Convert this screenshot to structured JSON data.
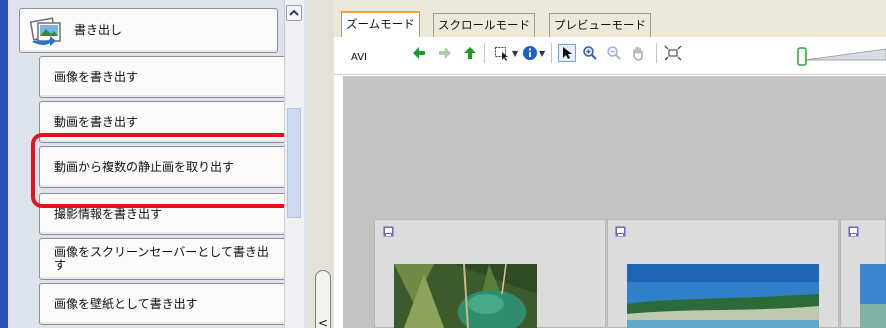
{
  "left_panel": {
    "section_header": "書き出し",
    "items": [
      "画像を書き出す",
      "動画を書き出す",
      "動画から複数の静止画を取り出す",
      "撮影情報を書き出す",
      "画像をスクリーンセーバーとして書き出す",
      "画像を壁紙として書き出す"
    ],
    "highlighted_item_index": 2
  },
  "tabs": [
    "ズームモード",
    "スクロールモード",
    "プレビューモード"
  ],
  "active_tab_index": 0,
  "toolbar": {
    "av_label": "AVI",
    "icons": [
      "back-arrow-icon",
      "forward-arrow-icon",
      "up-arrow-icon",
      "select-menu-icon",
      "info-icon",
      "pointer-icon",
      "zoom-in-icon",
      "zoom-out-icon",
      "hand-icon",
      "fit-icon"
    ]
  },
  "splitter": {
    "collapse_glyph": "<"
  },
  "colors": {
    "highlight": "#e8101b",
    "active_tab_accent": "#f7a23a",
    "left_strip": "#2a50b4",
    "nav_green": "#1c9a2a",
    "info_blue": "#1d5fd1"
  }
}
